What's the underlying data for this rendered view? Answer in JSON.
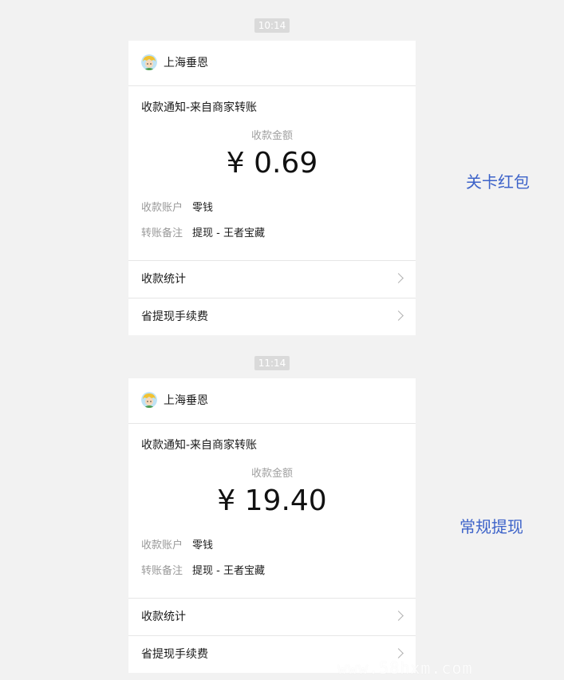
{
  "messages": [
    {
      "timestamp": "10:14",
      "merchant_name": "上海垂恩",
      "notice_title": "收款通知-来自商家转账",
      "amount_label": "收款金额",
      "amount": "¥ 0.69",
      "account_label": "收款账户",
      "account_value": "零钱",
      "remark_label": "转账备注",
      "remark_value": "提现 - 王者宝藏",
      "link_stats": "收款统计",
      "link_fee": "省提现手续费",
      "side_note": "关卡红包"
    },
    {
      "timestamp": "11:14",
      "merchant_name": "上海垂恩",
      "notice_title": "收款通知-来自商家转账",
      "amount_label": "收款金额",
      "amount": "¥ 19.40",
      "account_label": "收款账户",
      "account_value": "零钱",
      "remark_label": "转账备注",
      "remark_value": "提现 - 王者宝藏",
      "link_stats": "收款统计",
      "link_fee": "省提现手续费",
      "side_note": "常规提现"
    }
  ],
  "watermark": "www.58hxm.com",
  "colors": {
    "background": "#f2f2f2",
    "card": "#ffffff",
    "annotation": "#3d63c9",
    "muted_text": "#999999"
  },
  "icons": {
    "avatar": "cartoon-avatar-icon",
    "chevron": "chevron-right-icon"
  }
}
